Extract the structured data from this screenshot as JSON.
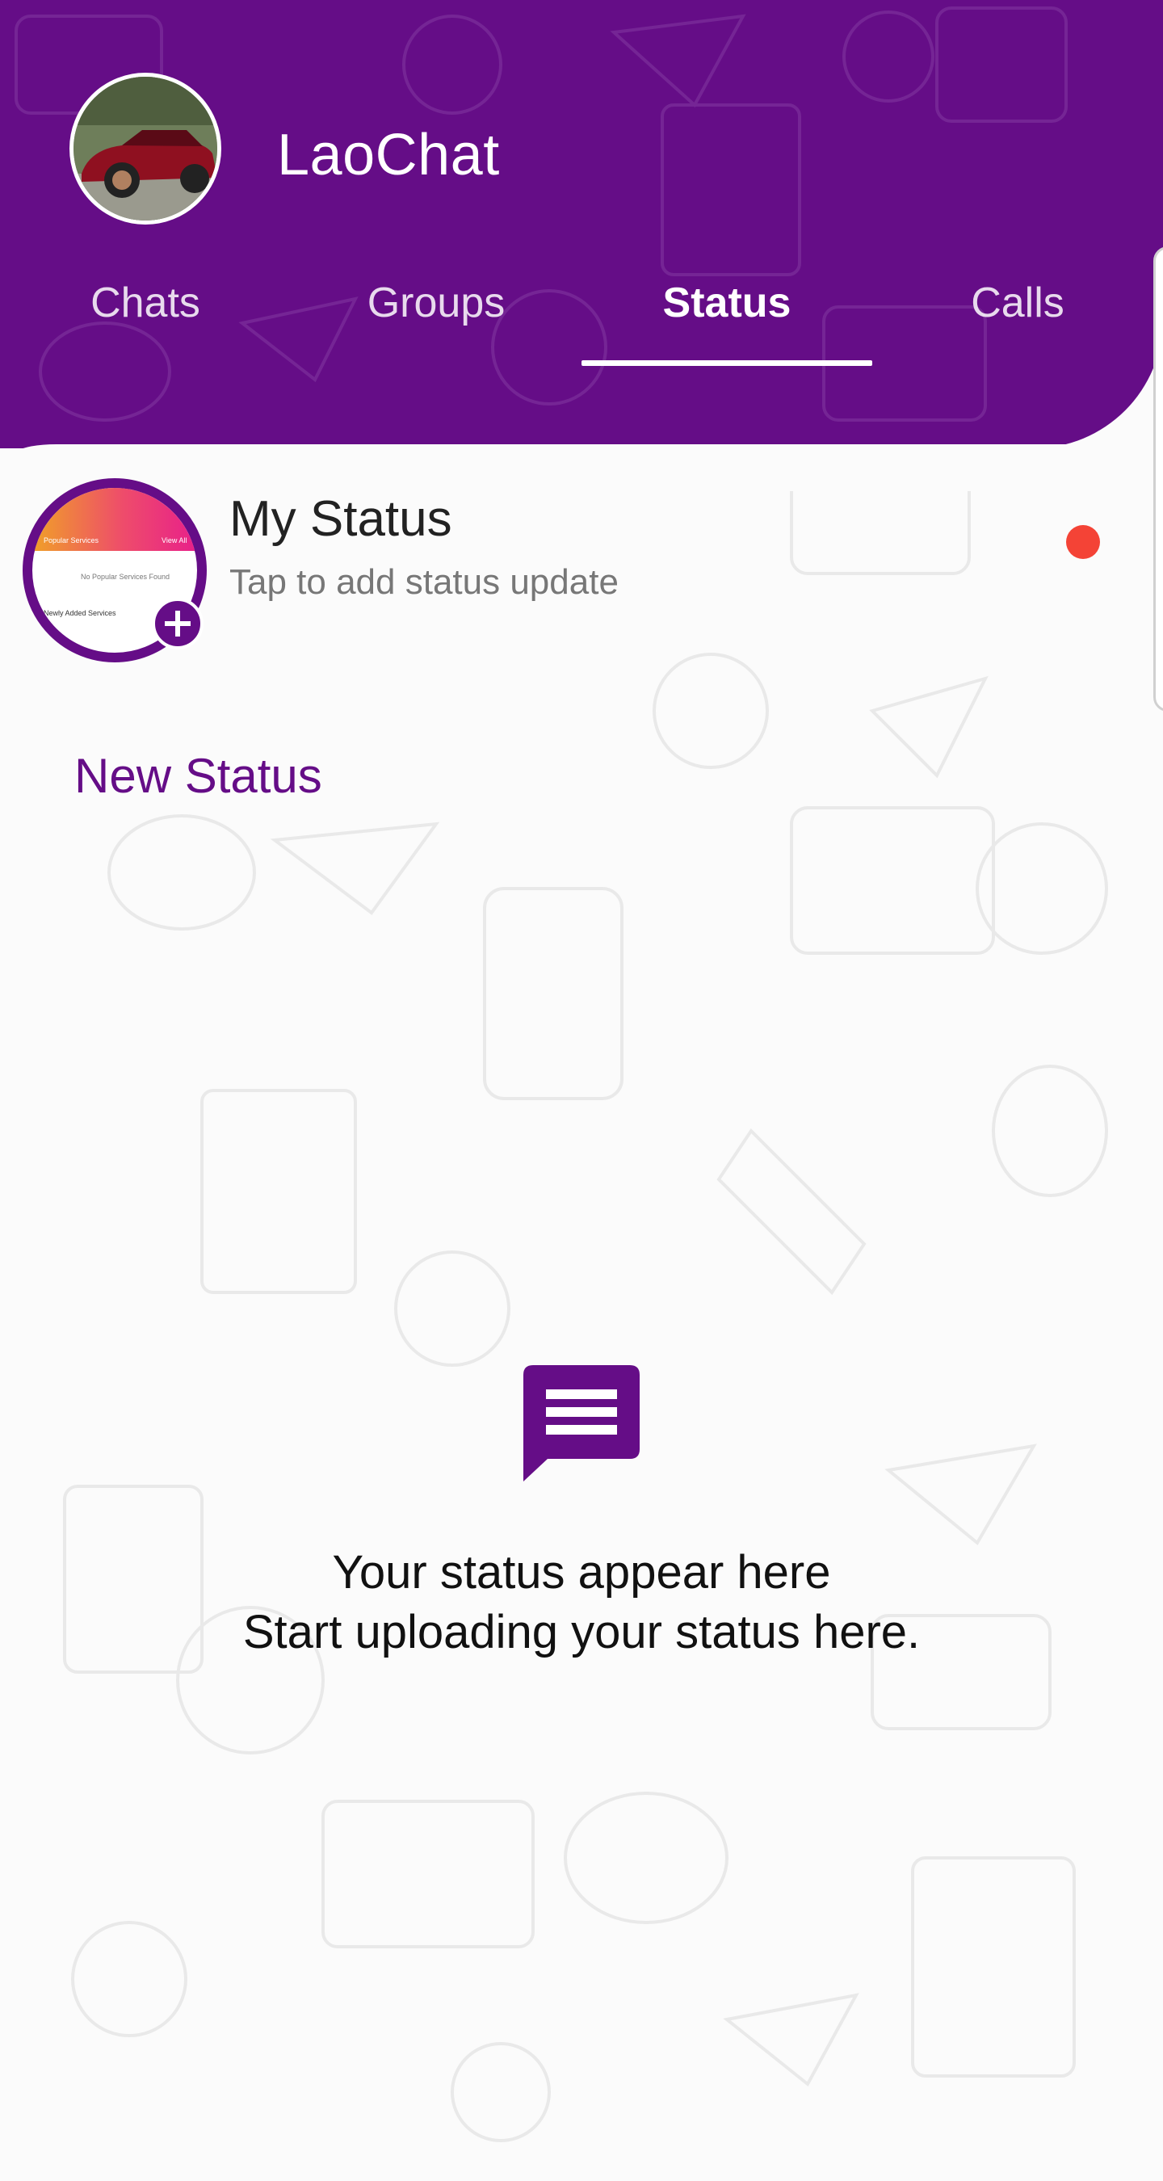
{
  "app": {
    "title": "LaoChat",
    "brand_color": "#650d87",
    "avatar_icon": "profile-photo-car"
  },
  "tabs": [
    {
      "label": "Chats",
      "active": false
    },
    {
      "label": "Groups",
      "active": false
    },
    {
      "label": "Status",
      "active": true
    },
    {
      "label": "Calls",
      "active": false
    }
  ],
  "my_status": {
    "title": "My Status",
    "subtitle": "Tap to add status update",
    "add_icon": "plus-icon",
    "indicator_color": "#f44336",
    "thumbnail": {
      "line_1": "Popular Services",
      "line_2": "View All",
      "line_3": "No Popular Services Found",
      "line_4": "Newly Added Services"
    }
  },
  "section": {
    "new_status_label": "New Status"
  },
  "empty_state": {
    "icon": "message-square-icon",
    "line_1": "Your status appear here",
    "line_2": "Start uploading your status here."
  }
}
